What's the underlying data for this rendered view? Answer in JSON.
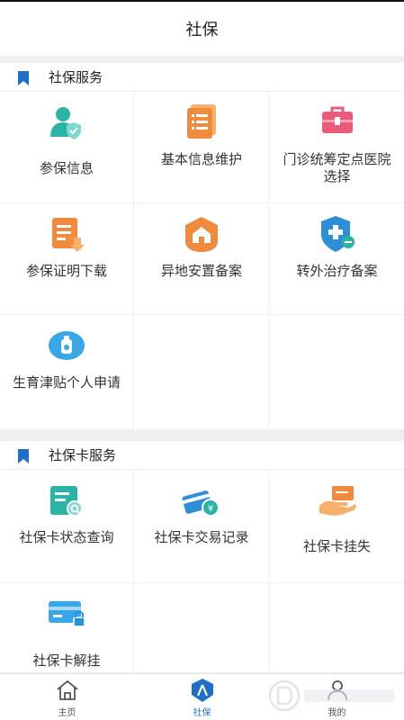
{
  "header": {
    "title": "社保"
  },
  "section1": {
    "title": "社保服务",
    "items": [
      {
        "label": "参保信息",
        "icon": "user-shield-icon"
      },
      {
        "label": "基本信息维护",
        "icon": "document-list-icon"
      },
      {
        "label": "门诊统筹定点医院选择",
        "icon": "medical-kit-icon"
      },
      {
        "label": "参保证明下载",
        "icon": "document-download-icon"
      },
      {
        "label": "异地安置备案",
        "icon": "house-icon"
      },
      {
        "label": "转外治疗备案",
        "icon": "medical-shield-icon"
      },
      {
        "label": "生育津贴个人申请",
        "icon": "baby-bottle-icon"
      }
    ]
  },
  "section2": {
    "title": "社保卡服务",
    "items": [
      {
        "label": "社保卡状态查询",
        "icon": "card-search-icon"
      },
      {
        "label": "社保卡交易记录",
        "icon": "card-yen-icon"
      },
      {
        "label": "社保卡挂失",
        "icon": "hand-card-icon"
      },
      {
        "label": "社保卡解挂",
        "icon": "card-lock-icon"
      }
    ]
  },
  "tabbar": {
    "tabs": [
      {
        "label": "主页",
        "icon": "home-icon"
      },
      {
        "label": "社保",
        "icon": "social-security-icon"
      },
      {
        "label": "我的",
        "icon": "user-icon"
      }
    ]
  },
  "colors": {
    "accent": "#1e6fc8",
    "teal": "#2bb3a5",
    "orange": "#f08a3c",
    "pink": "#ec5a7a"
  }
}
